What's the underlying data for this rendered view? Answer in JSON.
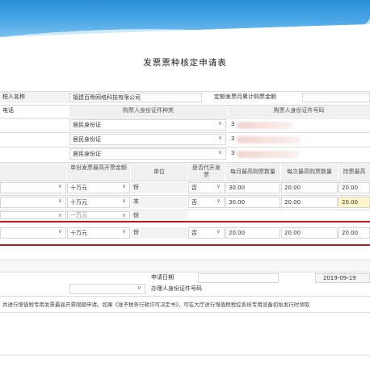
{
  "form": {
    "title": "发票票种核定申请表",
    "taxpayer_name_label": "税人名称",
    "taxpayer_name_value": "福建百骨网络科技有限公司",
    "invoice_total_label": "定额发票月累计购票金额",
    "phone_label": "电话",
    "id_type_header": "购票人身份证件种类",
    "id_number_header": "购票人身份证件号码",
    "id_rows": [
      {
        "type": "居民身份证",
        "number": "3"
      },
      {
        "type": "居民身份证",
        "number": "3"
      },
      {
        "type": "居民身份证",
        "number": "3"
      }
    ],
    "invoice_headers": [
      "单份发票最高开票金额",
      "单位",
      "是否代开发票",
      "每月最高购票数量",
      "每次最高购票数量",
      "持票最高"
    ],
    "invoice_rows": [
      {
        "max": "十万元",
        "unit": "份",
        "agent": "否",
        "monthly": "30.00",
        "each": "20.00",
        "hold": "20.00"
      },
      {
        "max": "十万元",
        "unit": "本",
        "agent": "否",
        "monthly": "30.00",
        "each": "20.00",
        "hold": "20.00"
      },
      {
        "max": "一万元",
        "unit": "份",
        "agent": "否",
        "monthly": "30.00",
        "each": "20.00",
        "hold": "20.00"
      },
      {
        "max": "十万元",
        "unit": "份",
        "agent": "否",
        "monthly": "20.00",
        "each": "20.00",
        "hold": "20.00"
      }
    ],
    "apply_date_label": "申请日期",
    "apply_date_value": "2019-09-19",
    "agent_id_label": "办理人身份证件号码",
    "footer_note": "并进行增值税专用发票最高开票限额申请。如果《准予税务行政许可决定书》，可在大厅进行增值税税控系统专用设备初始发行时领取"
  },
  "colors": {
    "banner": "#2b8fd8",
    "highlight_border": "#c8151b",
    "selected_row": "#fdf7c7"
  }
}
